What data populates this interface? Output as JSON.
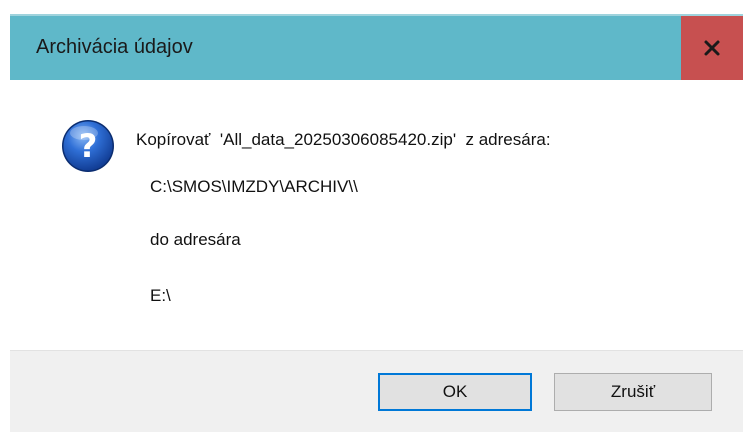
{
  "window": {
    "title": "Archivácia údajov",
    "close_label": "x"
  },
  "message": {
    "line1": "Kopírovať  'All_data_20250306085420.zip'  z adresára:",
    "line2": "C:\\SMOS\\IMZDY\\ARCHIV\\\\",
    "line3": "do adresára",
    "line4": "E:\\"
  },
  "buttons": {
    "ok_label": "OK",
    "cancel_label": "Zrušiť"
  },
  "icons": {
    "message_icon": "question-icon",
    "close_icon": "close-icon"
  },
  "colors": {
    "titlebar": "#5fb8c9",
    "close_button": "#c75050",
    "footer": "#f0f0f0",
    "default_button_border": "#0078d7"
  }
}
